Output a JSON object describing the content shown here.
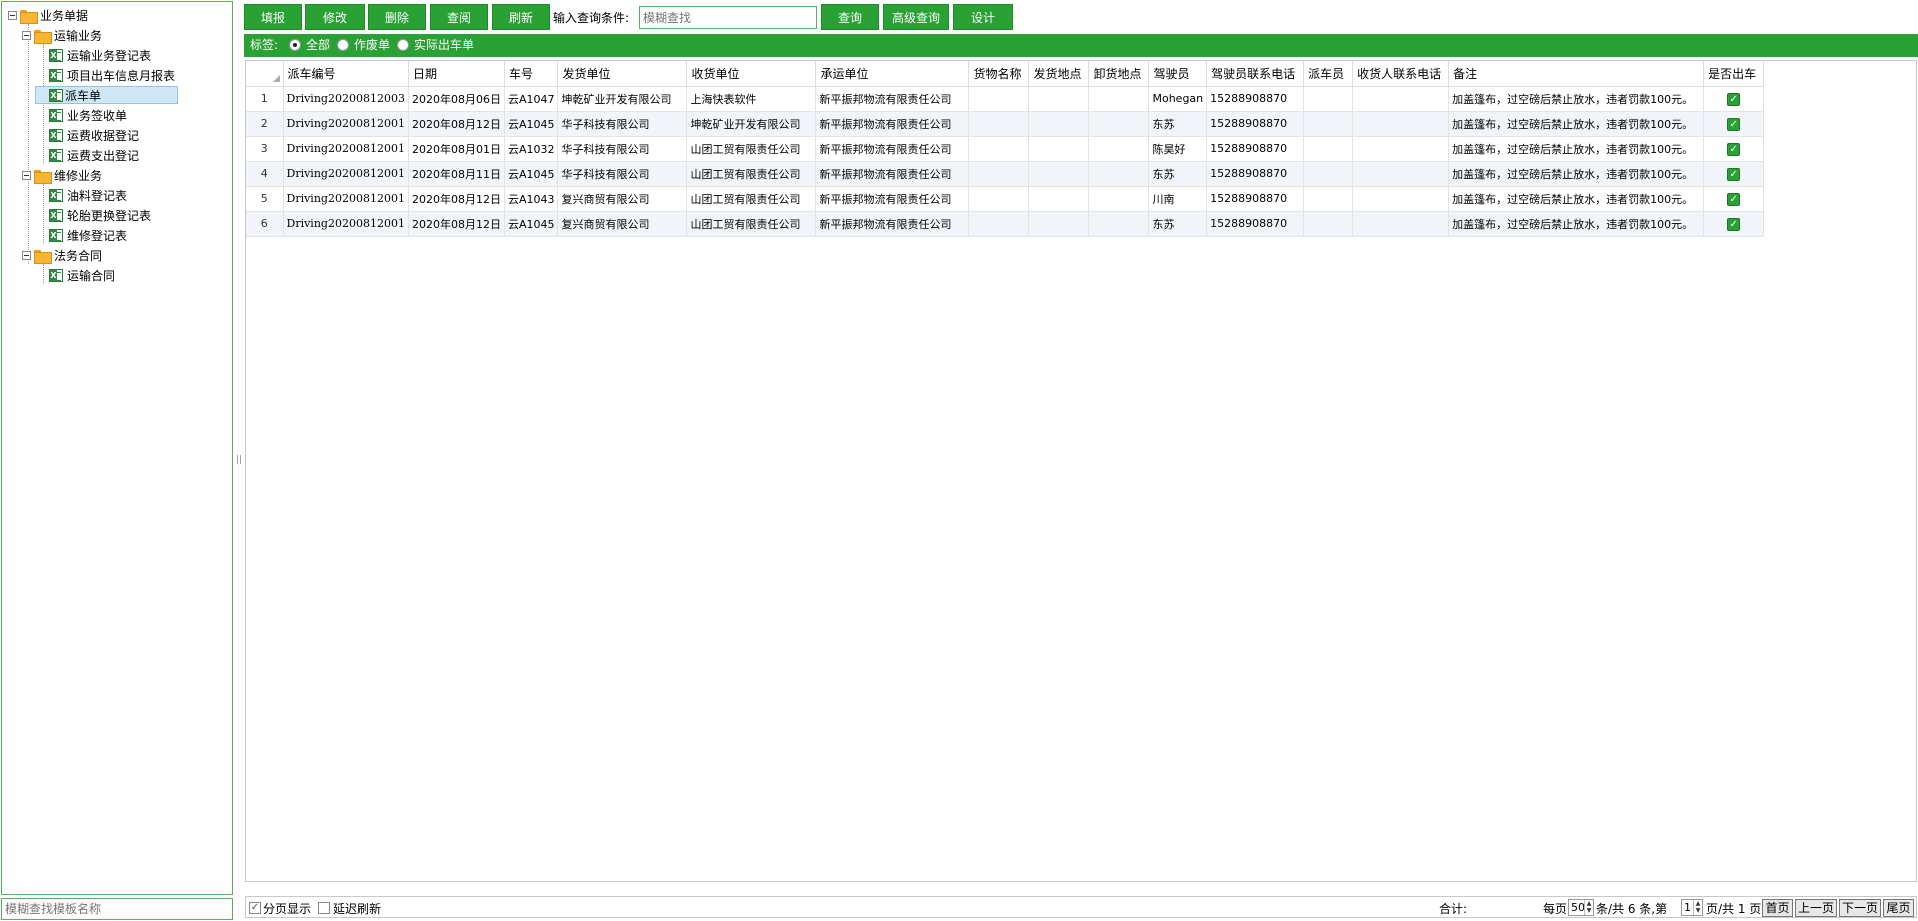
{
  "tree": {
    "root": "业务单据",
    "groups": [
      {
        "label": "运输业务",
        "items": [
          "运输业务登记表",
          "项目出车信息月报表",
          "派车单",
          "业务签收单",
          "运费收据登记",
          "运费支出登记"
        ]
      },
      {
        "label": "维修业务",
        "items": [
          "油料登记表",
          "轮胎更换登记表",
          "维修登记表"
        ]
      },
      {
        "label": "法务合同",
        "items": [
          "运输合同"
        ]
      }
    ],
    "selected": "派车单",
    "search_placeholder": "模糊查找模板名称"
  },
  "toolbar": {
    "buttons": [
      "填报",
      "修改",
      "删除",
      "查阅",
      "刷新"
    ],
    "query_label": "输入查询条件:",
    "query_placeholder": "模糊查找",
    "query_button": "查询",
    "advanced_button": "高级查询",
    "design_button": "设计"
  },
  "tags": {
    "label": "标签:",
    "options": [
      "全部",
      "作废单",
      "实际出车单"
    ],
    "selected": "全部"
  },
  "grid": {
    "columns": [
      "派车编号",
      "日期",
      "车号",
      "发货单位",
      "收货单位",
      "承运单位",
      "货物名称",
      "发货地点",
      "卸货地点",
      "驾驶员",
      "驾驶员联系电话",
      "派车员",
      "收货人联系电话",
      "备注",
      "是否出车"
    ],
    "rows": [
      {
        "num": "1",
        "cells": [
          "Driving20200812003",
          "2020年08月06日",
          "云A1047",
          "坤乾矿业开发有限公司",
          "上海快表软件",
          "新平振邦物流有限责任公司",
          "",
          "",
          "",
          "Mohegan",
          "15288908870",
          "",
          "",
          "加盖篷布，过空磅后禁止放水，违者罚款100元。"
        ],
        "checked": true
      },
      {
        "num": "2",
        "cells": [
          "Driving20200812001",
          "2020年08月12日",
          "云A1045",
          "华子科技有限公司",
          "坤乾矿业开发有限公司",
          "新平振邦物流有限责任公司",
          "",
          "",
          "",
          "东苏",
          "15288908870",
          "",
          "",
          "加盖篷布，过空磅后禁止放水，违者罚款100元。"
        ],
        "checked": true
      },
      {
        "num": "3",
        "cells": [
          "Driving20200812001",
          "2020年08月01日",
          "云A1032",
          "华子科技有限公司",
          "山团工贸有限责任公司",
          "新平振邦物流有限责任公司",
          "",
          "",
          "",
          "陈昊好",
          "15288908870",
          "",
          "",
          "加盖篷布，过空磅后禁止放水，违者罚款100元。"
        ],
        "checked": true
      },
      {
        "num": "4",
        "cells": [
          "Driving20200812001",
          "2020年08月11日",
          "云A1045",
          "华子科技有限公司",
          "山团工贸有限责任公司",
          "新平振邦物流有限责任公司",
          "",
          "",
          "",
          "东苏",
          "15288908870",
          "",
          "",
          "加盖篷布，过空磅后禁止放水，违者罚款100元。"
        ],
        "checked": true
      },
      {
        "num": "5",
        "cells": [
          "Driving20200812001",
          "2020年08月12日",
          "云A1043",
          "复兴商贸有限公司",
          "山团工贸有限责任公司",
          "新平振邦物流有限责任公司",
          "",
          "",
          "",
          "川南",
          "15288908870",
          "",
          "",
          "加盖篷布，过空磅后禁止放水，违者罚款100元。"
        ],
        "checked": true
      },
      {
        "num": "6",
        "cells": [
          "Driving20200812001",
          "2020年08月12日",
          "云A1045",
          "复兴商贸有限公司",
          "山团工贸有限责任公司",
          "新平振邦物流有限责任公司",
          "",
          "",
          "",
          "东苏",
          "15288908870",
          "",
          "",
          "加盖篷布，过空磅后禁止放水，违者罚款100元。"
        ],
        "checked": true
      }
    ]
  },
  "footer": {
    "paging_label": "分页显示",
    "paging_checked": true,
    "delay_label": "延迟刷新",
    "delay_checked": false,
    "total_label": "合计:",
    "per_page_label": "每页",
    "per_page_value": "50",
    "records_text": "条/共 6 条,第",
    "page_value": "1",
    "pages_text": "页/共 1 页",
    "first_button": "首页",
    "prev_button": "上一页",
    "next_button": "下一页",
    "last_button": "尾页"
  },
  "colors": {
    "accent": "#2aa134",
    "border": "#58b05b",
    "selected_bg": "#cfe7f7"
  }
}
